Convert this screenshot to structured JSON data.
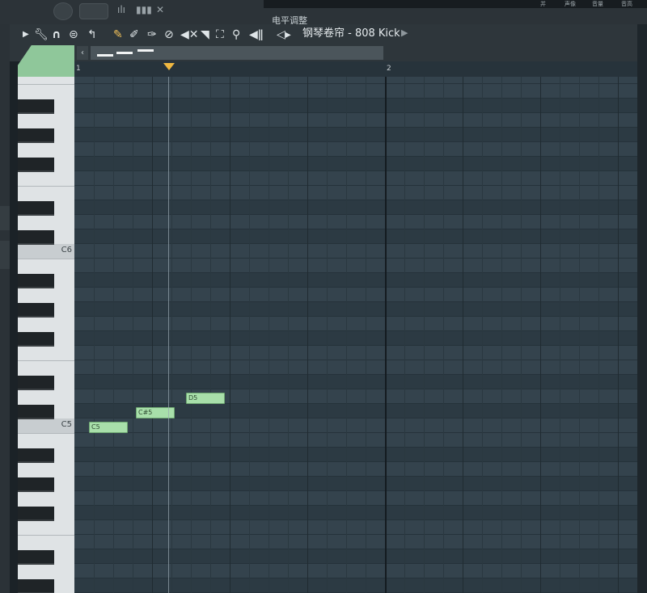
{
  "top": {
    "mixer_label": "电平调整",
    "mini_labels": [
      "并",
      "声像",
      "音量",
      "音高"
    ],
    "icons": [
      "bars-icon",
      "grid-icon",
      "close-icon"
    ]
  },
  "toolbar": {
    "title": "钢琴卷帘 - 808 Kick",
    "icons": [
      "arrow-right-icon",
      "wrench-icon",
      "magnet-icon",
      "menu-circle-icon",
      "undo-icon",
      "pencil-icon",
      "paint-icon",
      "paint-multi-icon",
      "delete-icon",
      "mute-icon",
      "select-icon",
      "slice-icon",
      "zoom-icon",
      "playback-icon",
      "speaker-icon"
    ]
  },
  "ruler": {
    "bar_labels": [
      "1",
      "2"
    ]
  },
  "piano": {
    "octave_labels": [
      "C6",
      "C5"
    ]
  },
  "notes": [
    {
      "label": "C5"
    },
    {
      "label": "C#5"
    },
    {
      "label": "D5"
    }
  ],
  "colors": {
    "note": "#a8dfaa",
    "playhead_marker": "#f0b841",
    "accent_tab": "#8fc79a"
  }
}
